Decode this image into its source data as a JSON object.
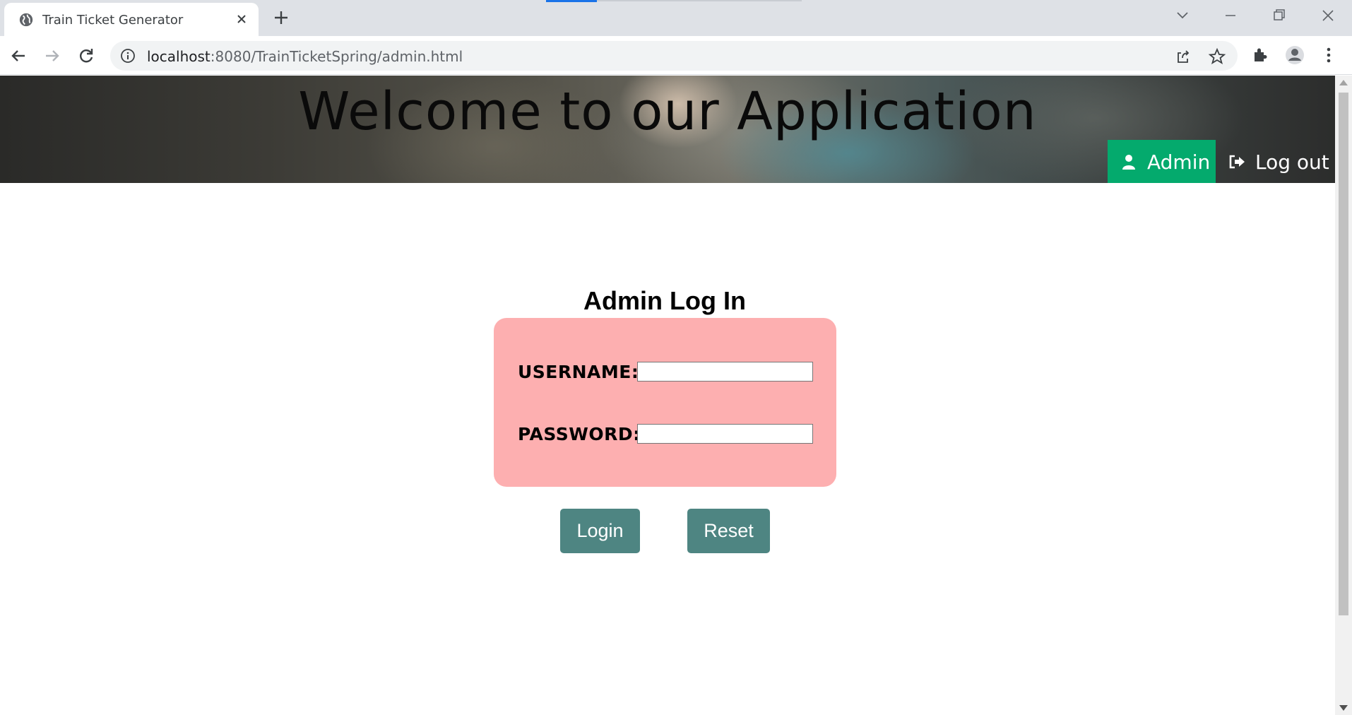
{
  "browser": {
    "tab_title": "Train Ticket Generator",
    "url_host": "localhost",
    "url_path": ":8080/TrainTicketSpring/admin.html"
  },
  "header": {
    "title": "Welcome to our Application",
    "nav": {
      "admin_label": "Admin",
      "logout_label": "Log out"
    },
    "colors": {
      "admin_active": "#04aa6d"
    }
  },
  "login": {
    "heading": "Admin Log In",
    "username_label": "USERNAME:",
    "password_label": "PASSWORD:",
    "username_value": "",
    "password_value": "",
    "login_button": "Login",
    "reset_button": "Reset",
    "colors": {
      "box_background": "#fdafb0",
      "button_background": "#4e8582"
    }
  }
}
